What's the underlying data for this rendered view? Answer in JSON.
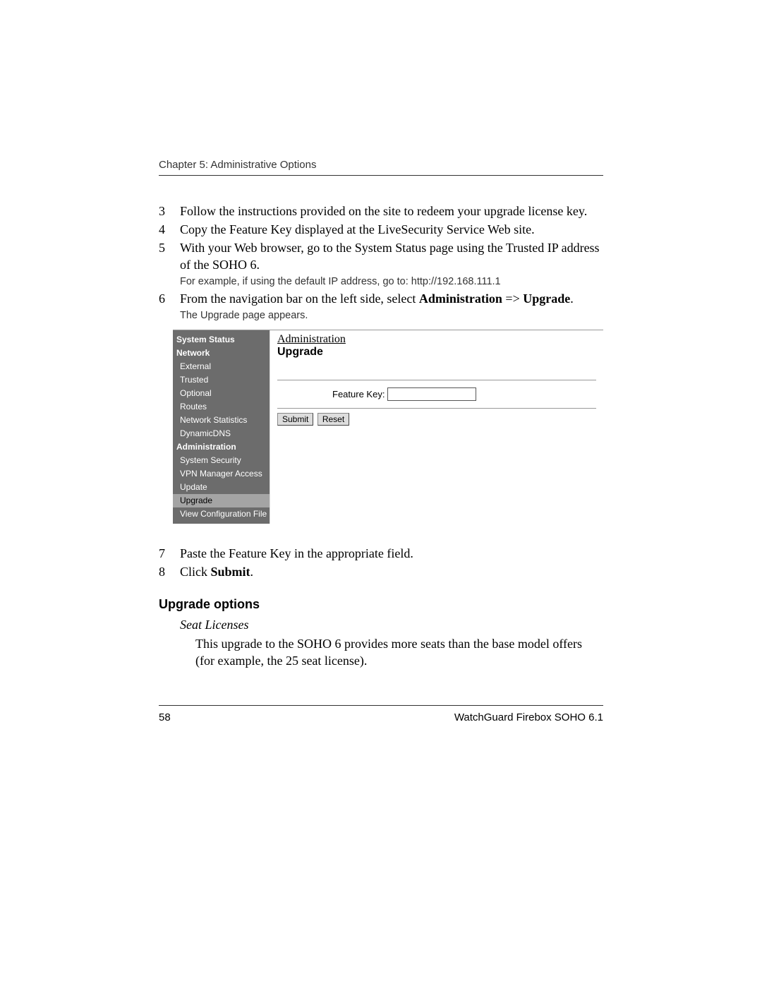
{
  "header": {
    "chapter": "Chapter 5: Administrative Options"
  },
  "steps": {
    "s3": {
      "n": "3",
      "text": "Follow the instructions provided on the site to redeem your upgrade license key."
    },
    "s4": {
      "n": "4",
      "text": "Copy the Feature Key displayed at the LiveSecurity Service Web site."
    },
    "s5": {
      "n": "5",
      "text": "With your Web browser, go to the System Status page using the Trusted IP address of the SOHO 6.",
      "sub": "For example, if using the default IP address, go to: http://192.168.111.1"
    },
    "s6": {
      "n": "6",
      "pre": "From the navigation bar on the left side, select ",
      "bold1": "Administration",
      "arrow": " => ",
      "bold2": "Upgrade",
      "post": ".",
      "sub": "The Upgrade page appears."
    },
    "s7": {
      "n": "7",
      "text": "Paste the Feature Key in the appropriate field."
    },
    "s8": {
      "n": "8",
      "pre": "Click ",
      "bold": "Submit",
      "post": "."
    }
  },
  "ui": {
    "nav": {
      "sysstatus": "System Status",
      "network": "Network",
      "external": "External",
      "trusted": "Trusted",
      "optional": "Optional",
      "routes": "Routes",
      "netstats": "Network Statistics",
      "dyndns": "DynamicDNS",
      "admin": "Administration",
      "syssec": "System Security",
      "vpn": "VPN Manager Access",
      "update": "Update",
      "upgrade": "Upgrade",
      "viewcfg": "View Configuration File"
    },
    "panel": {
      "breadcrumb": "Administration",
      "title": "Upgrade",
      "fk_label": "Feature Key:",
      "fk_value": "",
      "submit": "Submit",
      "reset": "Reset"
    }
  },
  "section": {
    "heading": "Upgrade options",
    "sub_title": "Seat Licenses",
    "sub_body": "This upgrade to the SOHO 6 provides more seats than the base model offers (for example, the 25 seat license)."
  },
  "footer": {
    "page": "58",
    "doc": "WatchGuard Firebox SOHO 6.1"
  }
}
